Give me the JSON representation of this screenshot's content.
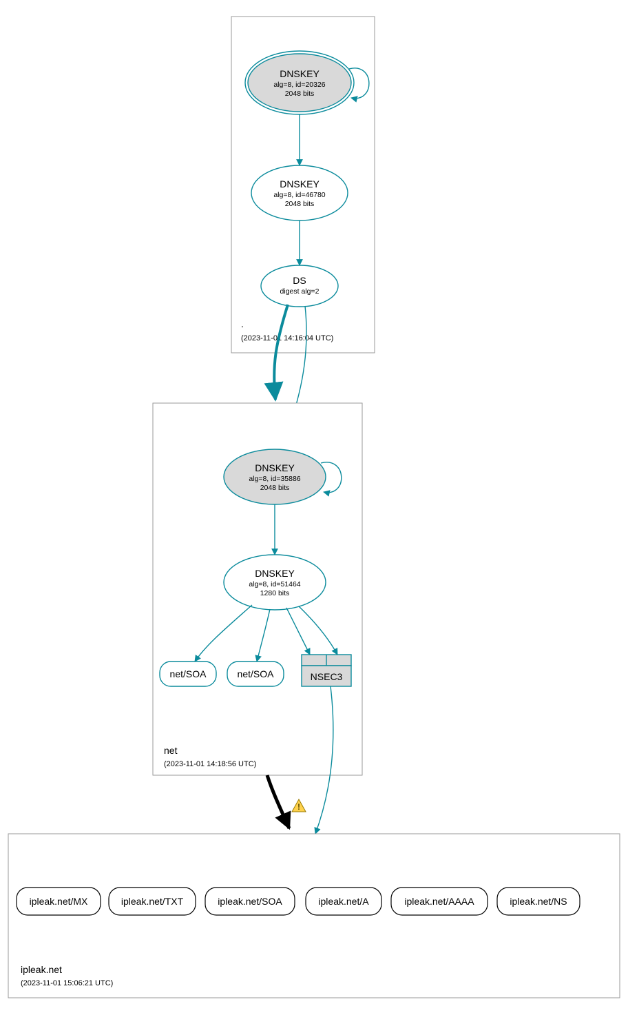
{
  "colors": {
    "teal": "#0b8b9c",
    "gray": "#d9d9d9",
    "zoneBorder": "#9a9a9a"
  },
  "zones": {
    "root": {
      "label": ".",
      "timestamp": "(2023-11-01 14:16:04 UTC)",
      "nodes": {
        "dnskey1": {
          "title": "DNSKEY",
          "sub1": "alg=8, id=20326",
          "sub2": "2048 bits"
        },
        "dnskey2": {
          "title": "DNSKEY",
          "sub1": "alg=8, id=46780",
          "sub2": "2048 bits"
        },
        "ds": {
          "title": "DS",
          "sub1": "digest alg=2"
        }
      }
    },
    "net": {
      "label": "net",
      "timestamp": "(2023-11-01 14:18:56 UTC)",
      "nodes": {
        "dnskey1": {
          "title": "DNSKEY",
          "sub1": "alg=8, id=35886",
          "sub2": "2048 bits"
        },
        "dnskey2": {
          "title": "DNSKEY",
          "sub1": "alg=8, id=51464",
          "sub2": "1280 bits"
        },
        "soa1": {
          "label": "net/SOA"
        },
        "soa2": {
          "label": "net/SOA"
        },
        "nsec3": {
          "label": "NSEC3"
        }
      }
    },
    "ipleak": {
      "label": "ipleak.net",
      "timestamp": "(2023-11-01 15:06:21 UTC)",
      "records": [
        {
          "label": "ipleak.net/MX"
        },
        {
          "label": "ipleak.net/TXT"
        },
        {
          "label": "ipleak.net/SOA"
        },
        {
          "label": "ipleak.net/A"
        },
        {
          "label": "ipleak.net/AAAA"
        },
        {
          "label": "ipleak.net/NS"
        }
      ]
    }
  },
  "warningGlyph": "!"
}
